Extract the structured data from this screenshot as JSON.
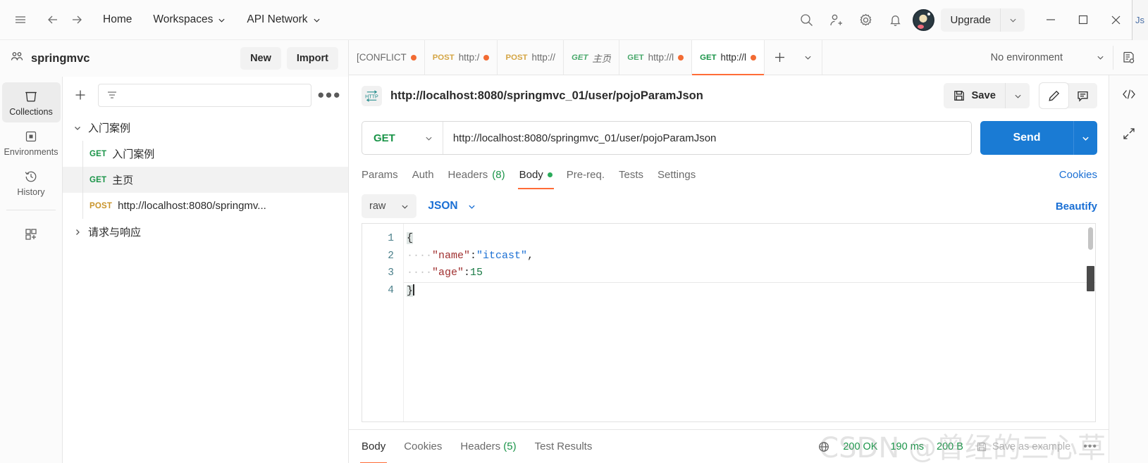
{
  "topbar": {
    "menu_icon": "hamburger-icon",
    "back_icon": "arrow-left-icon",
    "forward_icon": "arrow-right-icon",
    "home_label": "Home",
    "workspaces_label": "Workspaces",
    "api_network_label": "API Network",
    "search_icon": "search-icon",
    "invite_icon": "person-add-icon",
    "settings_icon": "gear-icon",
    "notifications_icon": "bell-icon",
    "avatar": "user-avatar",
    "upgrade_label": "Upgrade",
    "minimize_label": "—",
    "maximize_label": "□",
    "close_label": "✕",
    "edge_peek_text": "Js"
  },
  "workspace": {
    "name": "springmvc",
    "new_label": "New",
    "import_label": "Import"
  },
  "rail": {
    "items": [
      {
        "label": "Collections",
        "icon": "collections-icon",
        "active": true
      },
      {
        "label": "Environments",
        "icon": "environments-icon",
        "active": false
      },
      {
        "label": "History",
        "icon": "history-icon",
        "active": false
      }
    ],
    "apps_icon": "apps-add-icon"
  },
  "collections_toolbar": {
    "add_icon": "plus-icon",
    "filter_icon": "filter-icon",
    "search_placeholder": "",
    "more_label": "●●●"
  },
  "tree": [
    {
      "type": "folder",
      "label": "入门案例",
      "expanded": true,
      "twisty": "chevron-down-icon"
    },
    {
      "type": "request",
      "method": "GET",
      "label": "入门案例",
      "selected": false
    },
    {
      "type": "request",
      "method": "GET",
      "label": "主页",
      "selected": true
    },
    {
      "type": "request",
      "method": "POST",
      "label": "http://localhost:8080/springmv...",
      "selected": false
    },
    {
      "type": "folder",
      "label": "请求与响应",
      "expanded": false,
      "twisty": "chevron-right-icon"
    }
  ],
  "tabs": [
    {
      "method": "",
      "title": "[CONFLICT",
      "dirty": true,
      "active": false,
      "italic": false
    },
    {
      "method": "POST",
      "title": "http:/",
      "dirty": true,
      "active": false,
      "italic": false
    },
    {
      "method": "POST",
      "title": "http://",
      "dirty": false,
      "active": false,
      "italic": false
    },
    {
      "method": "GET",
      "title": "主页",
      "dirty": false,
      "active": false,
      "italic": true
    },
    {
      "method": "GET",
      "title": "http://l",
      "dirty": true,
      "active": false,
      "italic": false
    },
    {
      "method": "GET",
      "title": "http://l",
      "dirty": true,
      "active": true,
      "italic": false
    }
  ],
  "tabbar": {
    "add_icon": "plus-icon",
    "list_icon": "chevron-down-icon",
    "environment_label": "No environment",
    "env_caret_icon": "chevron-down-icon",
    "env_eye_icon": "environment-quick-look-icon"
  },
  "request_header": {
    "protocol_badge": "HTTP",
    "title": "http://localhost:8080/springmvc_01/user/pojoParamJson",
    "save_label": "Save",
    "save_icon": "floppy-disk-icon",
    "save_caret_icon": "chevron-down-icon",
    "edit_icon": "pencil-icon",
    "comment_icon": "comment-icon"
  },
  "side_tools": {
    "code_icon": "code-brackets-icon",
    "expand_icon": "diagonal-arrows-icon"
  },
  "url_row": {
    "method": "GET",
    "method_caret_icon": "chevron-down-icon",
    "url": "http://localhost:8080/springmvc_01/user/pojoParamJson",
    "send_label": "Send",
    "send_caret_icon": "chevron-down-icon"
  },
  "request_tabs": [
    {
      "label": "Params",
      "active": false
    },
    {
      "label": "Auth",
      "active": false
    },
    {
      "label": "Headers",
      "count": "(8)",
      "active": false
    },
    {
      "label": "Body",
      "active": true,
      "dot": true
    },
    {
      "label": "Pre-req.",
      "active": false
    },
    {
      "label": "Tests",
      "active": false
    },
    {
      "label": "Settings",
      "active": false
    }
  ],
  "cookies_link": "Cookies",
  "body_tools": {
    "mode": "raw",
    "mode_caret_icon": "chevron-down-icon",
    "format": "JSON",
    "format_caret_icon": "chevron-down-icon",
    "beautify_label": "Beautify"
  },
  "editor": {
    "line_numbers": [
      "1",
      "2",
      "3",
      "4"
    ],
    "lines": [
      {
        "n": "1",
        "text": "{"
      },
      {
        "n": "2",
        "key": "\"name\"",
        "colon": ":",
        "value": "\"itcast\"",
        "comma": ","
      },
      {
        "n": "3",
        "key": "\"age\"",
        "colon": ":",
        "value": "15"
      },
      {
        "n": "4",
        "text": "}"
      }
    ],
    "raw_json": "{\n    \"name\":\"itcast\",\n    \"age\":15\n}"
  },
  "response": {
    "tabs": [
      {
        "label": "Body",
        "active": true
      },
      {
        "label": "Cookies",
        "active": false
      },
      {
        "label": "Headers",
        "count": "(5)",
        "active": false
      },
      {
        "label": "Test Results",
        "active": false
      }
    ],
    "globe_icon": "globe-icon",
    "status": "200 OK",
    "time": "190 ms",
    "size": "200 B",
    "save_example_label": "Save as example",
    "save_example_icon": "floppy-disk-icon",
    "more_icon": "ellipsis-icon"
  },
  "watermark": "CSDN @曾经的三心草",
  "colors": {
    "accent_orange": "#ff6c37",
    "send_blue": "#1a7bd4",
    "link_blue": "#1a6fd4",
    "get_green": "#1a9448",
    "post_yellow": "#c9942a",
    "dirty_dot": "#f26b33",
    "http_badge": "#1f8a8a"
  }
}
